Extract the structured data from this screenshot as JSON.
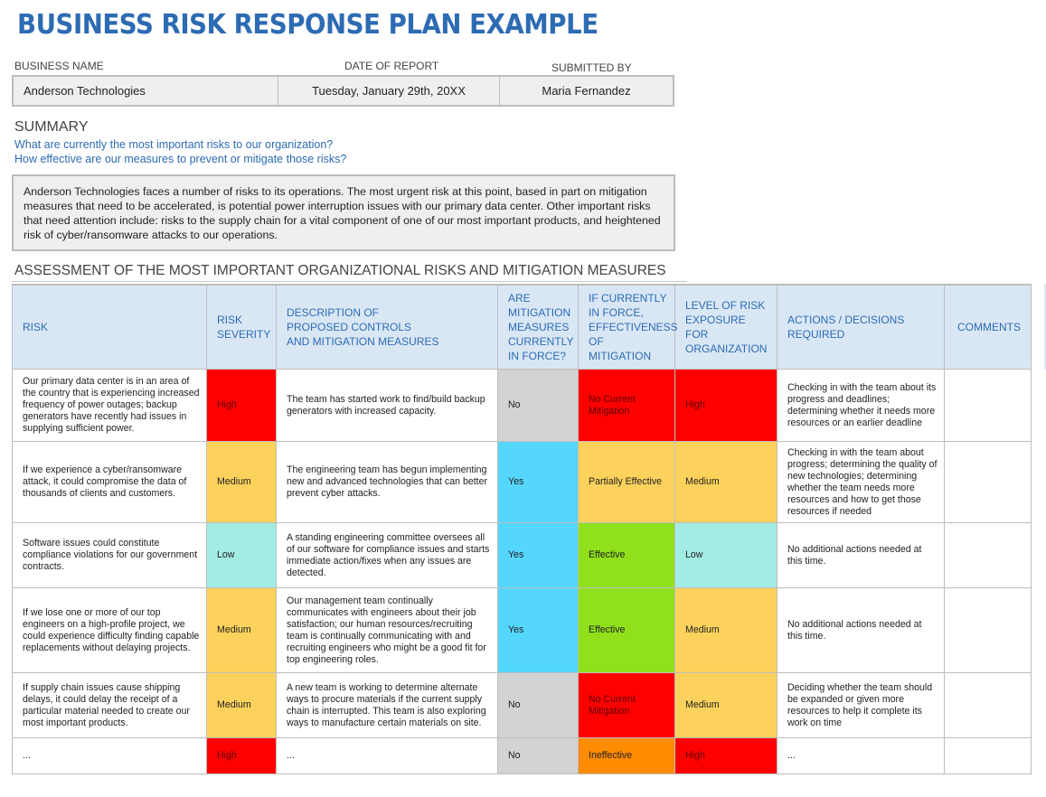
{
  "title": "BUSINESS RISK RESPONSE PLAN EXAMPLE",
  "meta": {
    "business_name_label": "BUSINESS NAME",
    "date_label": "DATE OF REPORT",
    "submitted_label": "SUBMITTED BY",
    "business_name": "Anderson Technologies",
    "date": "Tuesday, January 29th, 20XX",
    "submitted_by": "Maria Fernandez"
  },
  "summary": {
    "heading": "SUMMARY",
    "questions": [
      "What are currently the most important risks to our organization?",
      "How effective are our measures to prevent or mitigate those risks?"
    ],
    "text": "Anderson Technologies faces a number of risks to its operations. The most urgent risk at this point, based in part on mitigation measures that need to be accelerated, is potential power interruption issues with our primary data center. Other important risks that need attention include: risks to the supply chain for a vital component of one of our most important products, and heightened risk of cyber/ransomware attacks to our operations."
  },
  "assessment": {
    "heading": "ASSESSMENT OF THE MOST IMPORTANT ORGANIZATIONAL RISKS AND MITIGATION MEASURES",
    "columns": [
      "RISK",
      "RISK\nSEVERITY",
      "DESCRIPTION OF\nPROPOSED CONTROLS\nAND MITIGATION MEASURES",
      "ARE\nMITIGATION\nMEASURES\nCURRENTLY\nIN FORCE?",
      "IF CURRENTLY\nIN FORCE,\nEFFECTIVENESS\nOF MITIGATION",
      "LEVEL OF RISK\nEXPOSURE FOR\nORGANIZATION",
      "ACTIONS / DECISIONS\nREQUIRED",
      "COMMENTS"
    ],
    "colors": {
      "High": "#ff0000",
      "Medium": "#fdd25c",
      "Low": "#a3ece4",
      "Yes": "#55d6fc",
      "No": "#d3d3d3",
      "No Current Mitigation": "#ff0000",
      "Partially Effective": "#fdd25c",
      "Effective": "#90e01c",
      "Ineffective": "#ff8b00"
    },
    "rows": [
      {
        "risk": "Our primary data center is in an area of the country that is experiencing increased frequency of power outages; backup generators have recently had issues in supplying sufficient power.",
        "severity": "High",
        "description": "The team has started work to find/build backup generators with increased capacity.",
        "in_force": "No",
        "effectiveness": "No Current\nMitigation",
        "effectiveness_key": "No Current Mitigation",
        "exposure": "High",
        "actions": "Checking in with the team about its progress and deadlines; determining whether it needs more resources or an earlier deadline",
        "comments": ""
      },
      {
        "risk": "If we experience a cyber/ransomware attack, it could compromise the data of thousands of clients and customers.",
        "severity": "Medium",
        "description": "The engineering team has begun implementing new and advanced technologies that can better prevent cyber attacks.",
        "in_force": "Yes",
        "effectiveness": "Partially Effective",
        "effectiveness_key": "Partially Effective",
        "exposure": "Medium",
        "actions": "Checking in with the team about progress; determining the quality of new technologies; determining whether the team needs more resources and how to get those resources if needed",
        "comments": ""
      },
      {
        "risk": "Software issues could constitute compliance violations for our government contracts.",
        "severity": "Low",
        "description": "A standing engineering committee oversees all of our software for compliance issues and starts immediate action/fixes when any issues are detected.",
        "in_force": "Yes",
        "effectiveness": "Effective",
        "effectiveness_key": "Effective",
        "exposure": "Low",
        "actions": "No additional actions needed at this time.",
        "comments": ""
      },
      {
        "risk": "If we lose one or more of our top engineers on a high-profile project, we could experience difficulty finding capable replacements without delaying projects.",
        "severity": "Medium",
        "description": "Our management team continually communicates with engineers about their job satisfaction; our human resources/recruiting team is continually communicating with and recruiting engineers who might be a good fit for top engineering roles.",
        "in_force": "Yes",
        "effectiveness": "Effective",
        "effectiveness_key": "Effective",
        "exposure": "Medium",
        "actions": "No additional actions needed at this time.",
        "comments": ""
      },
      {
        "risk": "If supply chain issues cause shipping delays, it could delay the receipt of a particular material needed to create our most important products.",
        "severity": "Medium",
        "description": "A new team is working to determine alternate ways to procure materials if the current supply chain is interrupted. This team is also exploring ways to manufacture certain materials on site.",
        "in_force": "No",
        "effectiveness": "No Current\nMitigation",
        "effectiveness_key": "No Current Mitigation",
        "exposure": "Medium",
        "actions": "Deciding whether the team should be expanded or given more resources to help it complete its work on time",
        "comments": ""
      },
      {
        "risk": "...",
        "severity": "High",
        "description": "...",
        "in_force": "No",
        "effectiveness": "Ineffective",
        "effectiveness_key": "Ineffective",
        "exposure": "High",
        "actions": "...",
        "comments": ""
      }
    ]
  }
}
